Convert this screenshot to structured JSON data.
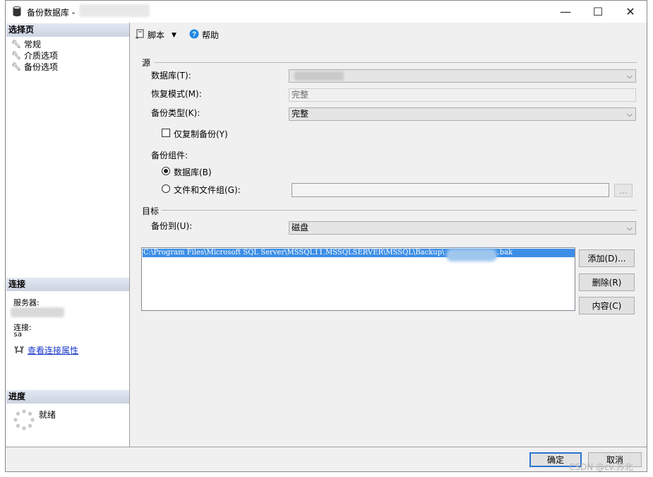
{
  "window": {
    "title": "备份数据库 -",
    "min": "—",
    "max": "☐",
    "close": "✕"
  },
  "left": {
    "select_page_header": "选择页",
    "nav": [
      "常规",
      "介质选项",
      "备份选项"
    ],
    "connection_header": "连接",
    "server_label": "服务器:",
    "connection_label": "连接:",
    "connection_value": "sa",
    "view_connection_link": "查看连接属性",
    "progress_header": "进度",
    "progress_status": "就绪"
  },
  "toolbar": {
    "script_label": "脚本",
    "help_label": "帮助"
  },
  "source": {
    "group_label": "源",
    "database_label": "数据库(T):",
    "database_value": "",
    "recovery_label": "恢复模式(M):",
    "recovery_value": "完整",
    "backup_type_label": "备份类型(K):",
    "backup_type_value": "完整",
    "copy_only_label": "仅复制备份(Y)",
    "component_label": "备份组件:",
    "radio_database": "数据库(B)",
    "radio_files": "文件和文件组(G):",
    "files_browse": "..."
  },
  "destination": {
    "group_label": "目标",
    "backup_to_label": "备份到(U):",
    "backup_to_value": "磁盘",
    "path_prefix": "C:\\Program Files\\Microsoft SQL Server\\MSSQL11.MSSQLSERVER\\MSSQL\\Backup\\",
    "path_suffix": ".bak",
    "add_button": "添加(D)...",
    "remove_button": "删除(R)",
    "contents_button": "内容(C)"
  },
  "footer": {
    "ok_button": "确定",
    "cancel_button": "取消"
  },
  "watermark": "CSDN @cv.苏北",
  "colors": {
    "selection": "#3c8ee6",
    "link": "#1a39c9",
    "help_icon": "#1e88e5",
    "default_button_border": "#2a73d1"
  },
  "icons": {
    "window": "database-icon",
    "nav": "wrench-icon",
    "script": "script-icon",
    "help": "help-icon",
    "connection": "connection-properties-icon",
    "progress": "spinner-icon"
  }
}
